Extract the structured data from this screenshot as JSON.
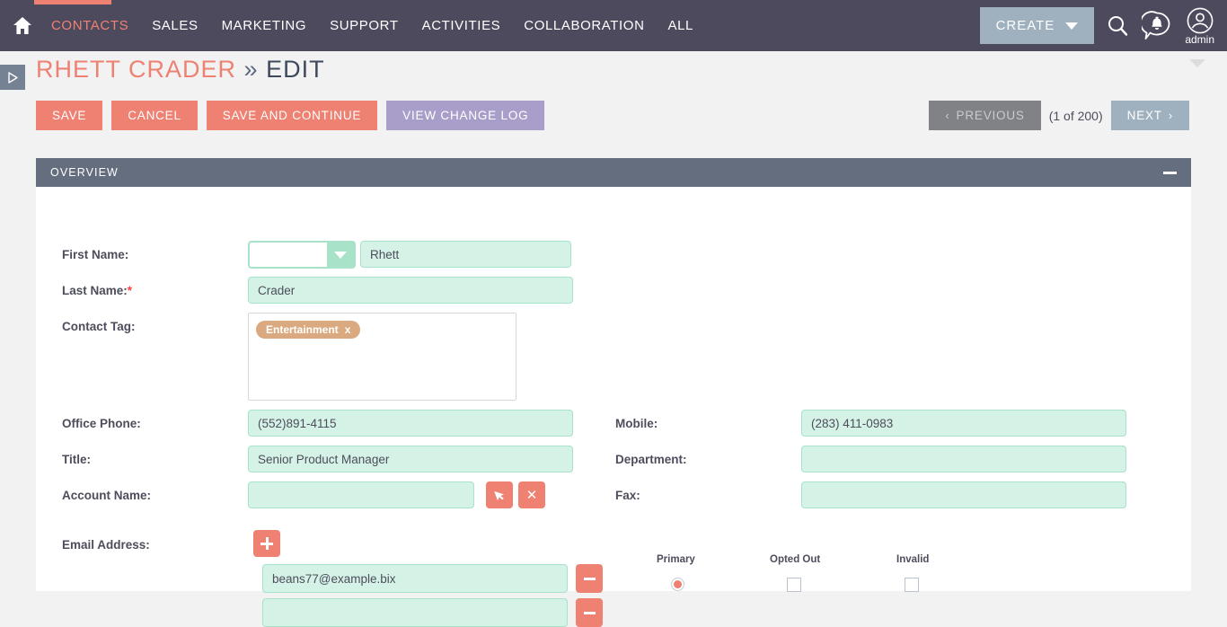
{
  "header": {
    "home_icon": "home-icon",
    "nav": [
      {
        "label": "CONTACTS",
        "active": true
      },
      {
        "label": "SALES",
        "active": false
      },
      {
        "label": "MARKETING",
        "active": false
      },
      {
        "label": "SUPPORT",
        "active": false
      },
      {
        "label": "ACTIVITIES",
        "active": false
      },
      {
        "label": "COLLABORATION",
        "active": false
      },
      {
        "label": "ALL",
        "active": false
      }
    ],
    "create_label": "CREATE",
    "search_icon": "search-icon",
    "notifications_icon": "notification-bell-icon",
    "avatar_icon": "user-avatar-icon",
    "avatar_name": "admin",
    "accent_color": "#ee8172",
    "background_color": "#4e4a5e"
  },
  "title": {
    "record_name": "RHETT CRADER",
    "separator": "»",
    "mode": "EDIT"
  },
  "actions": {
    "save": "SAVE",
    "cancel": "CANCEL",
    "save_and_continue": "SAVE AND CONTINUE",
    "view_change_log": "VIEW CHANGE LOG"
  },
  "pager": {
    "previous": "PREVIOUS",
    "count": "(1 of 200)",
    "next": "NEXT",
    "prev_chevron": "‹",
    "next_chevron": "›"
  },
  "panel": {
    "title": "OVERVIEW",
    "minimize_icon": "minimize-icon"
  },
  "form": {
    "first_name": {
      "label": "First Name:",
      "salutation_value": "",
      "value": "Rhett"
    },
    "last_name": {
      "label": "Last Name:",
      "required_marker": "*",
      "value": "Crader"
    },
    "contact_tag": {
      "label": "Contact Tag:",
      "tags": [
        {
          "label": "Entertainment",
          "remove": "x"
        }
      ]
    },
    "office_phone": {
      "label": "Office Phone:",
      "value": "(552)891-4115"
    },
    "mobile": {
      "label": "Mobile:",
      "value": "(283) 411-0983"
    },
    "title_field": {
      "label": "Title:",
      "value": "Senior Product Manager"
    },
    "department": {
      "label": "Department:",
      "value": ""
    },
    "account_name": {
      "label": "Account Name:",
      "value": "",
      "select_icon": "select-arrow-icon",
      "clear_icon": "clear-x-icon"
    },
    "fax": {
      "label": "Fax:",
      "value": ""
    },
    "email": {
      "label": "Email Address:",
      "add_icon": "add-plus-icon",
      "rows": [
        {
          "value": "beans77@example.bix",
          "remove_icon": "remove-minus-icon"
        },
        {
          "value": "",
          "remove_icon": "remove-minus-icon"
        }
      ],
      "columns": {
        "primary": "Primary",
        "opted_out": "Opted Out",
        "invalid": "Invalid"
      },
      "primary_selected": true,
      "opted_out_checked": false,
      "invalid_checked": false
    }
  },
  "sidebar_toggle": {
    "icon": "expand-sidebar-icon"
  }
}
